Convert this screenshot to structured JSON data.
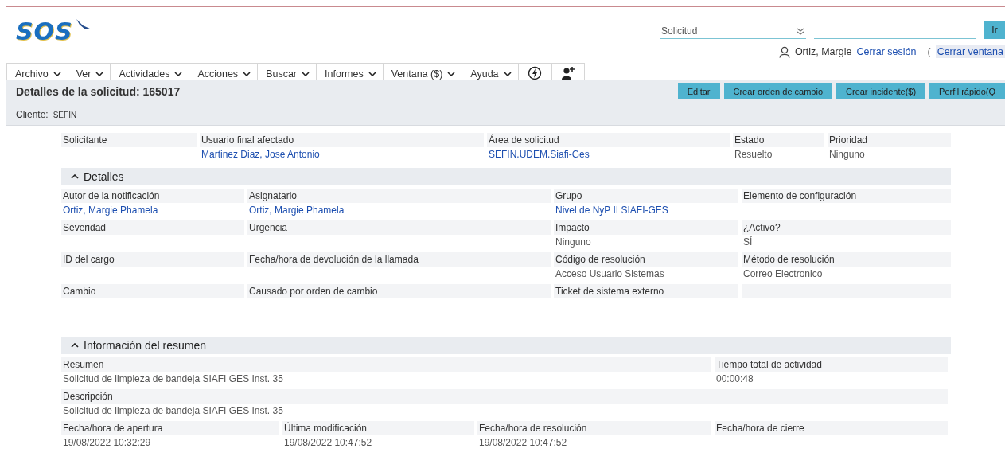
{
  "logo": {
    "text": "SOS"
  },
  "search": {
    "scope": "Solicitud",
    "button": "Ir"
  },
  "user": {
    "name": "Ortiz, Margie",
    "logout": "Cerrar sesión",
    "close_prefix": "(",
    "close_window": "Cerrar ventana"
  },
  "menu": [
    {
      "kind": "dropdown",
      "label": "Archivo"
    },
    {
      "kind": "dropdown",
      "label": "Ver"
    },
    {
      "kind": "dropdown",
      "label": "Actividades"
    },
    {
      "kind": "dropdown",
      "label": "Acciones"
    },
    {
      "kind": "dropdown",
      "label": "Buscar"
    },
    {
      "kind": "dropdown",
      "label": "Informes"
    },
    {
      "kind": "dropdown",
      "label": "Ventana ($)"
    },
    {
      "kind": "dropdown",
      "label": "Ayuda"
    },
    {
      "kind": "lightning"
    },
    {
      "kind": "add-person"
    }
  ],
  "title": "Detalles de la solicitud: 165017",
  "client": {
    "label": "Cliente:",
    "value": "SEFIN"
  },
  "actions": [
    "Editar",
    "Crear orden de cambio",
    "Crear incidente($)",
    "Perfil rápido(Q"
  ],
  "top_fields": [
    {
      "label": "Solicitante"
    },
    {
      "label": "Usuario final afectado",
      "value": "Martinez Diaz, Jose Antonio",
      "link": true
    },
    {
      "label": "Área de solicitud",
      "value": "SEFIN.UDEM.Siafi-Ges",
      "link": true
    },
    {
      "label": "Estado",
      "value": "Resuelto",
      "link": false
    },
    {
      "label": "Prioridad",
      "value": "Ninguno",
      "link": false
    }
  ],
  "sections": [
    {
      "title": "Detalles",
      "expanded": true,
      "kind": "details",
      "rows": [
        [
          {
            "label": "Autor de la notificación",
            "value": "Ortiz, Margie Phamela",
            "link": true
          },
          {
            "label": "Asignatario",
            "value": "Ortiz, Margie Phamela",
            "link": true
          },
          {
            "label": "Grupo",
            "value": "Nivel de NyP II SIAFI-GES",
            "link": true
          },
          {
            "label": "Elemento de configuración"
          }
        ],
        [
          {
            "label": "Severidad"
          },
          {
            "label": "Urgencia"
          },
          {
            "label": "Impacto",
            "value": "Ninguno",
            "link": false
          },
          {
            "label": "¿Activo?",
            "value": "SÍ",
            "link": false
          }
        ],
        [
          {
            "label": "ID del cargo"
          },
          {
            "label": "Fecha/hora de devolución de la llamada"
          },
          {
            "label": "Código de resolución",
            "value": "Acceso Usuario Sistemas",
            "link": false
          },
          {
            "label": "Método de resolución",
            "value": "Correo Electronico",
            "link": false
          }
        ],
        [
          {
            "label": "Cambio"
          },
          {
            "label": "Causado por orden de cambio"
          },
          {
            "label": "Ticket de sistema externo"
          },
          {}
        ]
      ]
    },
    {
      "title": "Información del resumen",
      "expanded": true,
      "kind": "summary",
      "rows": [
        [
          {
            "label": "Resumen",
            "value": "Solicitud de limpieza de bandeja SIAFI GES Inst. 35",
            "link": false
          },
          {},
          {},
          {
            "label": "Tiempo total de actividad",
            "value": "00:00:48",
            "link": false
          }
        ],
        [
          {
            "label": "Descripción",
            "value": "Solicitud de limpieza de bandeja SIAFI GES Inst. 35",
            "link": false
          },
          {},
          {},
          {}
        ],
        [
          {
            "label": "Fecha/hora de apertura",
            "value": "19/08/2022 10:32:29",
            "link": false
          },
          {
            "label": "Última modificación",
            "value": "19/08/2022 10:47:52",
            "link": false
          },
          {
            "label": "Fecha/hora de resolución",
            "value": "19/08/2022 10:47:52",
            "link": false
          },
          {
            "label": "Fecha/hora de cierre"
          }
        ]
      ]
    }
  ]
}
